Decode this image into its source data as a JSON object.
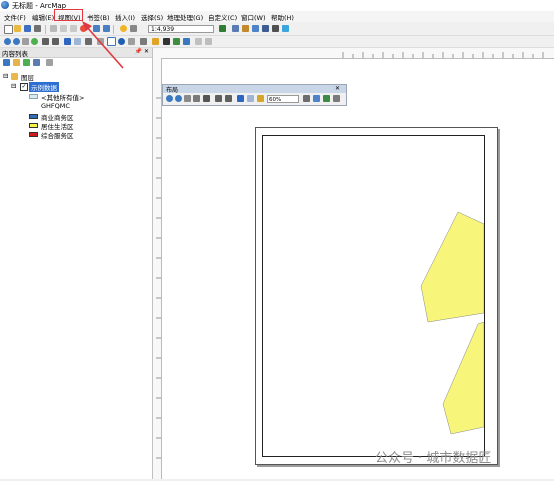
{
  "window": {
    "title": "无标题 - ArcMap"
  },
  "menu": {
    "items": [
      "文件(F)",
      "编辑(E)",
      "视图(V)",
      "书签(B)",
      "插入(I)",
      "选择(S)",
      "地理处理(G)",
      "自定义(C)",
      "窗口(W)",
      "帮助(H)"
    ],
    "highlighted": "视图(V)"
  },
  "toolbar": {
    "scale": "1:4,939"
  },
  "toc": {
    "title": "内容列表",
    "pin": "📌 ✕",
    "layers_root": "图层",
    "dataframe": "示例数据",
    "layer_name": "<其他所有值>",
    "field": "GHFQMC",
    "legend": [
      {
        "label": "商业商务区",
        "color": "#2f6fb6"
      },
      {
        "label": "居住生活区",
        "color": "#f6f34a"
      },
      {
        "label": "综合服务区",
        "color": "#d11b1b"
      }
    ]
  },
  "layout_toolbar": {
    "title": "布局",
    "zoom": "60%"
  },
  "map": {
    "polygon_color": "#f7f57a"
  },
  "watermark": "公众号 · 城市数据匠"
}
